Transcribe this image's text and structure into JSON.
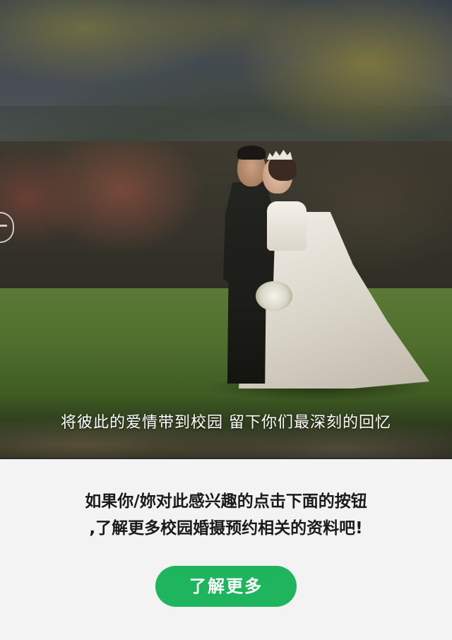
{
  "hero": {
    "caption": "将彼此的爱情带到校园  留下你们最深刻的回忆"
  },
  "info": {
    "line1": "如果你/妳对此感兴趣的点击下面的按钮",
    "line2": ",了解更多校园婚摄预约相关的资料吧!"
  },
  "cta": {
    "label": "了解更多",
    "color": "#1fb45e"
  }
}
